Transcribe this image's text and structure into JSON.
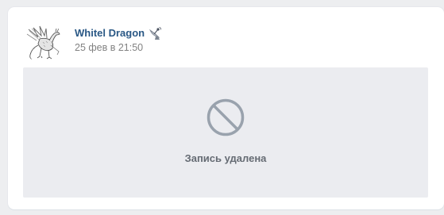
{
  "post": {
    "author": {
      "name": "Whitel Dragon",
      "avatar_icon": "dragon-avatar",
      "status_icon": "satellite-emoji"
    },
    "date": "25 фев в 21:50",
    "deleted": {
      "icon": "ban-icon",
      "message": "Запись удалена"
    }
  },
  "colors": {
    "page_background": "#edeef0",
    "card_background": "#ffffff",
    "author_link": "#2a5885",
    "date_text": "#828282",
    "deleted_background": "#ebecf0",
    "deleted_icon": "#99a2ad",
    "deleted_text": "#656b73"
  }
}
